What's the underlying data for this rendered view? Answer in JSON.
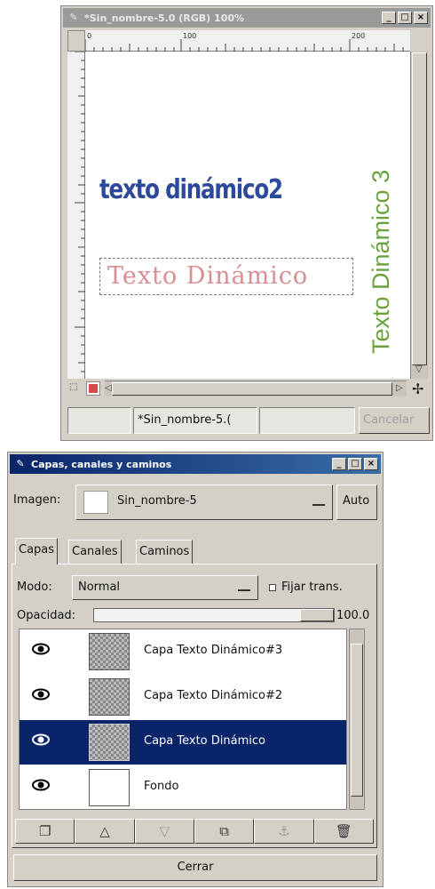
{
  "image_window": {
    "title": "*Sin_nombre-5.0 (RGB) 100%",
    "ruler": {
      "labels": [
        "0",
        "100",
        "200"
      ]
    },
    "canvas": {
      "text_layer_2": "texto dinámico2",
      "text_layer_1": "Texto Dinámico",
      "text_layer_3": "Texto Dinámico 3"
    },
    "status": {
      "filename": "*Sin_nombre-5.(",
      "cancel_label": "Cancelar"
    }
  },
  "layers_dialog": {
    "title": "Capas, canales y caminos",
    "image_label": "Imagen:",
    "image_value": "Sin_nombre-5",
    "auto_label": "Auto",
    "tabs": [
      "Capas",
      "Canales",
      "Caminos"
    ],
    "mode_label": "Modo:",
    "mode_value": "Normal",
    "lock_label": "Fijar trans.",
    "opacity_label": "Opacidad:",
    "opacity_value": "100.0",
    "layers": [
      {
        "name": "Capa Texto Dinámico#3",
        "selected": false
      },
      {
        "name": "Capa Texto Dinámico#2",
        "selected": false
      },
      {
        "name": "Capa Texto Dinámico",
        "selected": true
      },
      {
        "name": "Fondo",
        "selected": false
      }
    ],
    "close_label": "Cerrar"
  },
  "colors": {
    "blue_text": "#2d4a9a",
    "pink_text": "#d98f8f",
    "green_text": "#6aa33d",
    "selection": "#0a246a"
  }
}
